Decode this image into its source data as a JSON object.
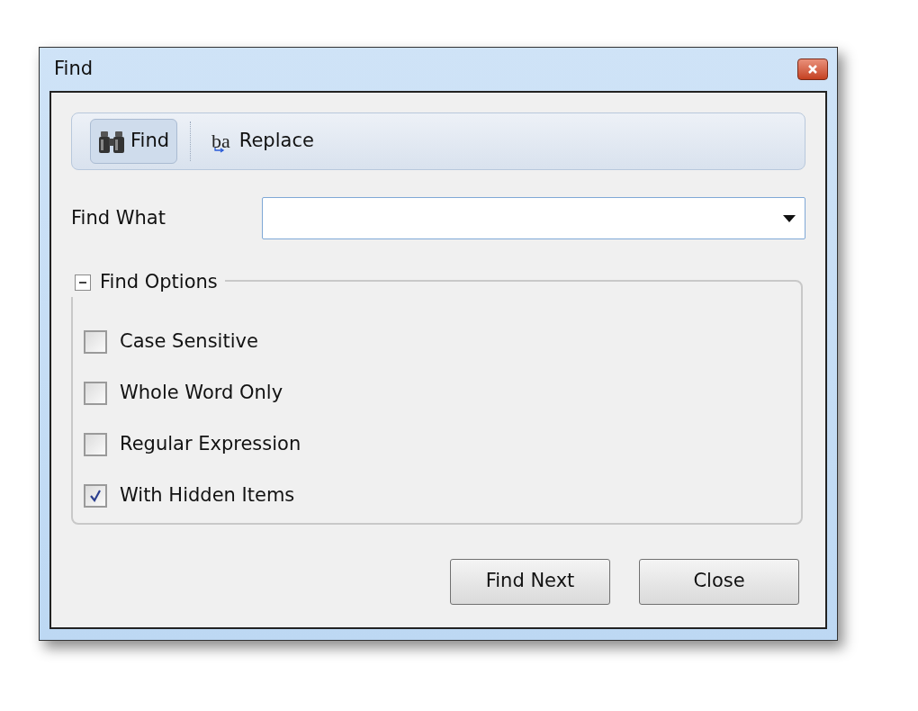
{
  "window": {
    "title": "Find"
  },
  "tabs": [
    {
      "label": "Find",
      "selected": true,
      "kind": "binoculars"
    },
    {
      "label": "Replace",
      "selected": false,
      "kind": "letters",
      "icon_text": "ba"
    }
  ],
  "find_what": {
    "label": "Find What"
  },
  "options": {
    "title": "Find Options",
    "expanded": true,
    "items": [
      {
        "label": "Case Sensitive",
        "checked": false
      },
      {
        "label": "Whole Word Only",
        "checked": false
      },
      {
        "label": "Regular Expression",
        "checked": false
      },
      {
        "label": "With Hidden Items",
        "checked": true
      }
    ]
  },
  "buttons": [
    "Find Next",
    "Close"
  ]
}
